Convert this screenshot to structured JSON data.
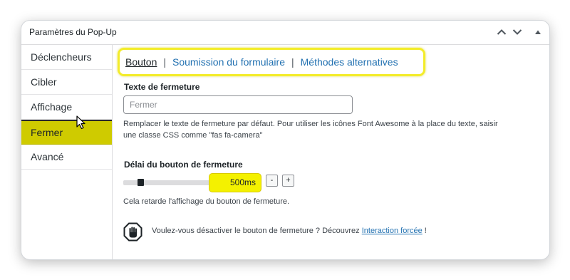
{
  "panel": {
    "title": "Paramètres du Pop-Up",
    "header_buttons": [
      "chevron-up-icon",
      "chevron-down-icon",
      "triangle-up-icon"
    ]
  },
  "sidebar": {
    "items": [
      {
        "label": "Déclencheurs"
      },
      {
        "label": "Cibler"
      },
      {
        "label": "Affichage"
      },
      {
        "label": "Fermer",
        "active": true
      },
      {
        "label": "Avancé"
      }
    ],
    "active_color": "#cfcb00"
  },
  "tabs": {
    "items": [
      {
        "label": "Bouton",
        "active": true
      },
      {
        "label": "Soumission du formulaire"
      },
      {
        "label": "Méthodes alternatives"
      }
    ],
    "separator": "|",
    "highlight_color": "#f3ec2a"
  },
  "close_text": {
    "label": "Texte de fermeture",
    "value": "",
    "placeholder": "Fermer",
    "description_line1": "Remplacer le texte de fermeture par défaut. Pour utiliser les icônes Font Awesome à la place du texte, saisir",
    "description_line2": "une classe CSS comme \"fas fa-camera\""
  },
  "delay": {
    "label": "Délai du bouton de fermeture",
    "value_text": "500ms",
    "minus": "-",
    "plus": "+",
    "description": "Cela retarde l'affichage du bouton de fermeture.",
    "highlight_color": "#f4f100"
  },
  "notice": {
    "icon": "stop-hand-icon",
    "text": "Voulez-vous désactiver le bouton de fermeture ? Découvrez ",
    "link": "Interaction forcée",
    "suffix": " !"
  },
  "colors": {
    "link": "#2271b1",
    "text": "#1d2327"
  }
}
